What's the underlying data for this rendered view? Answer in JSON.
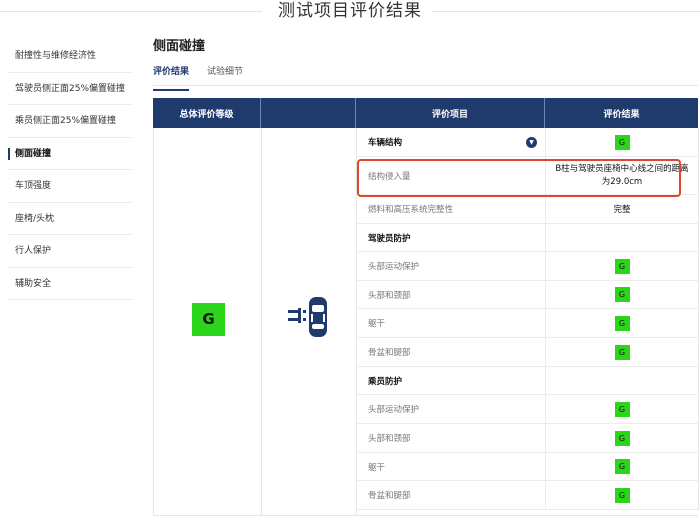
{
  "page_title": "测试项目评价结果",
  "sidebar": {
    "items": [
      {
        "label": "耐撞性与维修经济性"
      },
      {
        "label": "驾驶员侧正面25%偏置碰撞"
      },
      {
        "label": "乘员侧正面25%偏置碰撞"
      },
      {
        "label": "侧面碰撞"
      },
      {
        "label": "车顶强度"
      },
      {
        "label": "座椅/头枕"
      },
      {
        "label": "行人保护"
      },
      {
        "label": "辅助安全"
      }
    ],
    "active_index": 3
  },
  "section_title": "侧面碰撞",
  "tabs": [
    {
      "label": "评价结果"
    },
    {
      "label": "试验细节"
    }
  ],
  "table": {
    "headers": {
      "overall": "总体评价等级",
      "item": "评价项目",
      "result": "评价结果"
    },
    "overall_grade": "G",
    "grade_color": "#2bd51a",
    "header_color": "#1f3b6e",
    "highlight_color": "#e0452d",
    "rows": [
      {
        "item": "车辆结构",
        "result": "G",
        "type": "group"
      },
      {
        "item": "结构侵入量",
        "result": "B柱与驾驶员座椅中心线之间的距离为29.0cm",
        "type": "text"
      },
      {
        "item": "燃料和高压系统完整性",
        "result": "完整",
        "type": "text"
      },
      {
        "item": "驾驶员防护",
        "result": "",
        "type": "group-title"
      },
      {
        "item": "头部运动保护",
        "result": "G",
        "type": "grade"
      },
      {
        "item": "头部和颈部",
        "result": "G",
        "type": "grade"
      },
      {
        "item": "躯干",
        "result": "G",
        "type": "grade"
      },
      {
        "item": "骨盆和腿部",
        "result": "G",
        "type": "grade"
      },
      {
        "item": "乘员防护",
        "result": "",
        "type": "group-title"
      },
      {
        "item": "头部运动保护",
        "result": "G",
        "type": "grade"
      },
      {
        "item": "头部和颈部",
        "result": "G",
        "type": "grade"
      },
      {
        "item": "躯干",
        "result": "G",
        "type": "grade"
      },
      {
        "item": "骨盆和腿部",
        "result": "G",
        "type": "grade"
      }
    ]
  }
}
